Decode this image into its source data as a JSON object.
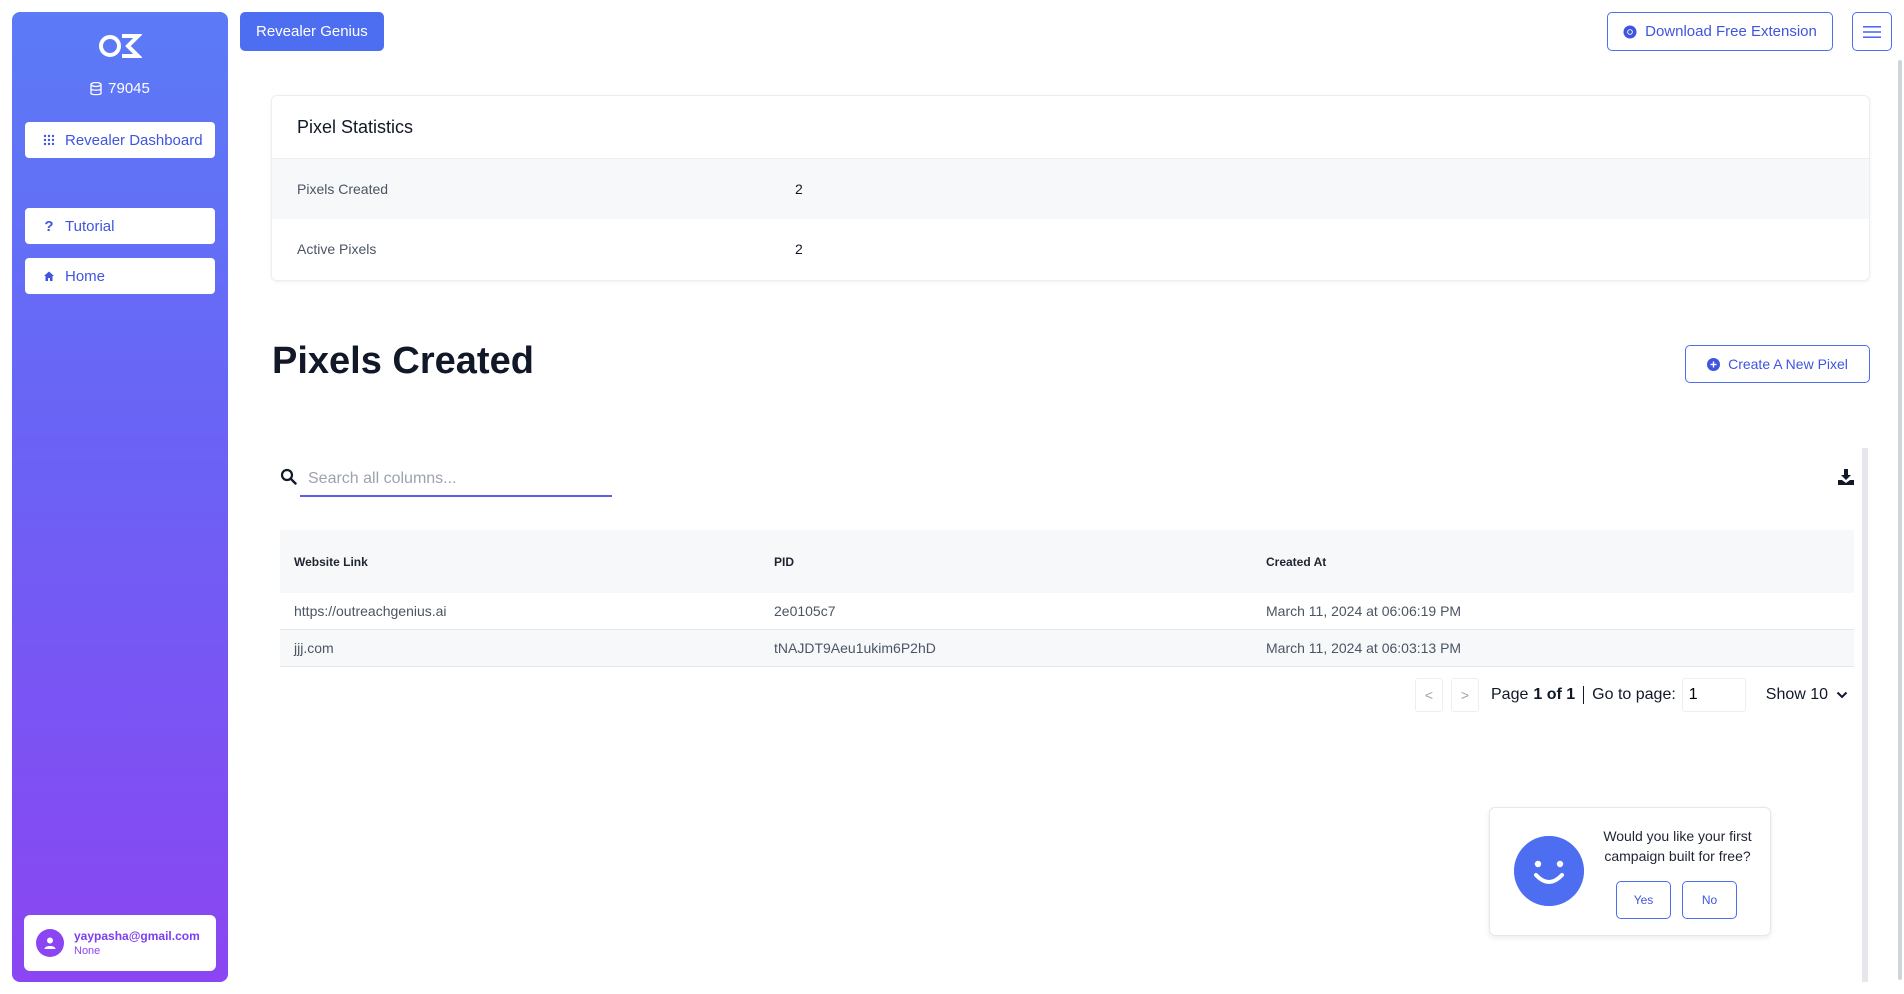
{
  "sidebar": {
    "credits": "79045",
    "dashboard_label": "Revealer Dashboard",
    "tutorial_label": "Tutorial",
    "home_label": "Home",
    "user": {
      "email": "yaypasha@gmail.com",
      "plan": "None"
    }
  },
  "topbar": {
    "brand_label": "Revealer Genius",
    "extension_label": "Download Free Extension"
  },
  "stats": {
    "title": "Pixel Statistics",
    "rows": [
      {
        "label": "Pixels Created",
        "value": "2"
      },
      {
        "label": "Active Pixels",
        "value": "2"
      }
    ]
  },
  "pixels": {
    "title": "Pixels Created",
    "create_label": "Create A New Pixel",
    "search_placeholder": "Search all columns...",
    "columns": [
      "Website Link",
      "PID",
      "Created At"
    ],
    "rows": [
      {
        "link": "https://outreachgenius.ai",
        "pid": "2e0105c7",
        "created": "March 11, 2024 at 06:06:19 PM"
      },
      {
        "link": "jjj.com",
        "pid": "tNAJDT9Aeu1ukim6P2hD",
        "created": "March 11, 2024 at 06:03:13 PM"
      }
    ]
  },
  "pagination": {
    "prev": "<",
    "next": ">",
    "page_prefix": "Page",
    "page_of": "1 of 1",
    "goto_label": "Go to page:",
    "goto_value": "1",
    "show_label": "Show 10"
  },
  "popup": {
    "message": "Would you like your first campaign built for free?",
    "yes": "Yes",
    "no": "No"
  },
  "colors": {
    "accent": "#4e6ef2",
    "sidebar_top": "#5b7bf7",
    "sidebar_bottom": "#8b45f2"
  }
}
